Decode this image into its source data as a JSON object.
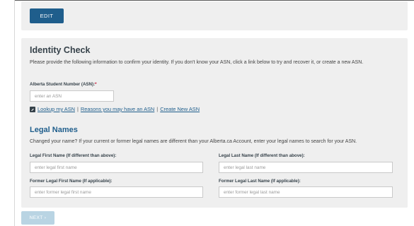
{
  "edit_panel": {
    "edit_label": "EDIT"
  },
  "identity": {
    "title": "Identity Check",
    "description": "Please provide the following information to confirm your identity. If you don't know your ASN, click a link below to try and recover it, or create a new ASN.",
    "asn_label": "Alberta Student Number (ASN):",
    "required_marker": "*",
    "asn_placeholder": "enter an ASN",
    "links": {
      "lookup": "Lookup my ASN",
      "reasons": "Reasons you may have an ASN",
      "create": "Create New ASN",
      "separator": "|"
    }
  },
  "legal": {
    "title": "Legal Names",
    "description": "Changed your name? If your current or former legal names are different than your Alberta.ca Account, enter your legal names to search for your ASN.",
    "first_label": "Legal First Name (If different than above):",
    "first_placeholder": "enter legal first name",
    "last_label": "Legal Last Name (If different than above):",
    "last_placeholder": "enter legal last name",
    "former_first_label": "Former Legal First Name (If applicable):",
    "former_first_placeholder": "enter former legal first name",
    "former_last_label": "Former Legal Last Name (If applicable):",
    "former_last_placeholder": "enter former legal last name"
  },
  "footer": {
    "next_label": "NEXT",
    "next_arrow": "›"
  },
  "colors": {
    "primary": "#1f5e8c",
    "panel_bg": "#efefef",
    "disabled": "#b9d4e3",
    "required": "#c8102e"
  }
}
